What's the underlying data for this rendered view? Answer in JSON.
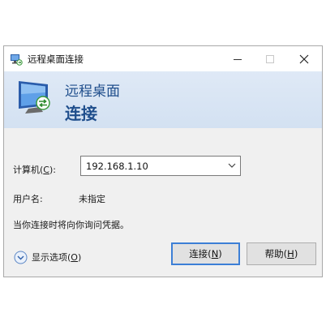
{
  "window": {
    "title": "远程桌面连接"
  },
  "banner": {
    "line1": "远程桌面",
    "line2": "连接"
  },
  "form": {
    "computer_label": "计算机(",
    "computer_label_key": "C",
    "computer_label_end": "):",
    "computer_value": "192.168.1.10",
    "user_label": "用户名:",
    "user_value": "未指定",
    "notice": "当你连接时将向你询问凭据。"
  },
  "footer": {
    "options_label": "显示选项(",
    "options_key": "O",
    "options_end": ")",
    "connect_label": "连接(",
    "connect_key": "N",
    "connect_end": ")",
    "help_label": "帮助(",
    "help_key": "H",
    "help_end": ")"
  },
  "colors": {
    "banner_text": "#1f4e8c",
    "default_button_border": "#3c7fd6"
  },
  "icons": {
    "title_icon": "remote-desktop-icon",
    "banner_icon": "remote-desktop-monitor-icon",
    "options_icon": "expand-chevron-icon",
    "combo_arrow": "chevron-down-icon"
  }
}
